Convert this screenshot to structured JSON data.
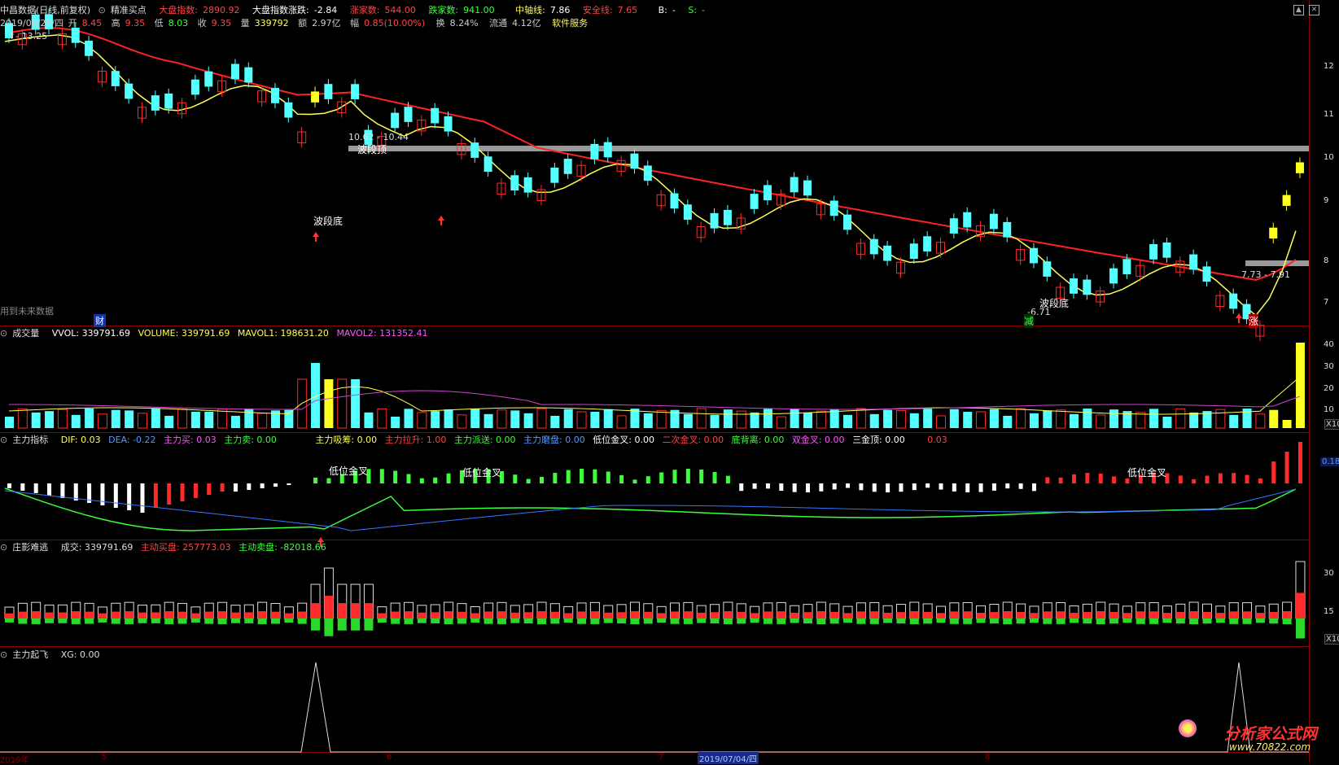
{
  "top_bar": {
    "title": "中昌数据(日线,前复权)",
    "indicator": "精准买点",
    "index_label": "大盘指数:",
    "index_value": "2890.92",
    "index_chg_label": "大盘指数涨跌:",
    "index_chg_value": "-2.84",
    "up_label": "涨家数:",
    "up_value": "544.00",
    "down_label": "跌家数:",
    "down_value": "941.00",
    "mid_label": "中轴线:",
    "mid_value": "7.86",
    "safe_label": "安全线:",
    "safe_value": "7.65",
    "b_label": "B:",
    "b_value": "-",
    "s_label": "S:",
    "s_value": "-"
  },
  "quote_bar": {
    "date": "2019/08/29/四",
    "open_label": "开",
    "open": "8.45",
    "high_label": "高",
    "high": "9.35",
    "low_label": "低",
    "low": "8.03",
    "close_label": "收",
    "close": "9.35",
    "vol_label": "量",
    "vol": "339792",
    "amt_label": "额",
    "amt": "2.97亿",
    "chg_label": "幅",
    "chg": "0.85(10.00%)",
    "turn_label": "换",
    "turn": "8.24%",
    "float_label": "流通",
    "float": "4.12亿",
    "service": "软件服务"
  },
  "main_chart": {
    "high_marker": "13.25",
    "peak_range": "10.62 - 10.44",
    "label_top": "波段顶",
    "label_bottom_1": "波段底",
    "label_bottom_2": "波段底",
    "low_value": "6.71",
    "recent_range": "7.73 - 7.91",
    "reduce_tag": "减",
    "rise_tag": "涨",
    "fin_tag": "财",
    "future_note": "用到未来数据",
    "y_ticks": [
      "12",
      "11",
      "10",
      "9",
      "8",
      "7"
    ]
  },
  "vol_panel": {
    "name": "成交量",
    "vvol": "VVOL: 339791.69",
    "volume": "VOLUME: 339791.69",
    "mavol1": "MAVOL1: 198631.20",
    "mavol2": "MAVOL2: 131352.41",
    "y_ticks": [
      "40",
      "30",
      "20",
      "10"
    ],
    "unit": "X10"
  },
  "force_panel": {
    "name": "主力指标",
    "dif": "DIF: 0.03",
    "dea": "DEA: -0.22",
    "buy": "主力买: 0.03",
    "sell": "主力卖: 0.00",
    "absorb": "主力吸筹: 0.00",
    "pull": "主力拉升: 1.00",
    "dispatch": "主力派送: 0.00",
    "grind": "主力磨盘: 0.00",
    "low_gold": "低位金叉: 0.00",
    "second_gold": "二次金叉: 0.00",
    "bottom_div": "底背离: 0.00",
    "double_gold": "双金叉: 0.00",
    "three_gold": "三金顶: 0.00",
    "last": "0.03",
    "cross_label_1": "低位金叉",
    "cross_label_2": "低位金叉",
    "cross_label_3": "低位金叉",
    "right_value": "0.18"
  },
  "shadow_panel": {
    "name": "庄影难逃",
    "volume": "成交: 339791.69",
    "active_buy": "主动买盘: 257773.03",
    "active_sell": "主动卖盘: -82018.66",
    "y_ticks": [
      "30",
      "15"
    ],
    "unit": "X10"
  },
  "takeoff_panel": {
    "name": "主力起飞",
    "xg": "XG: 0.00"
  },
  "x_axis": {
    "labels": [
      "2019年",
      "5",
      "6",
      "7",
      "8"
    ],
    "cursor_date": "2019/07/04/四"
  },
  "watermark": {
    "brand": "分析家公式网",
    "site": "www.70822.com"
  },
  "colors": {
    "up": "#ff2a2a",
    "down": "#54ffff",
    "ma_short": "#ffff55",
    "ma_long": "#ff2222",
    "axis": "#8b0000"
  }
}
